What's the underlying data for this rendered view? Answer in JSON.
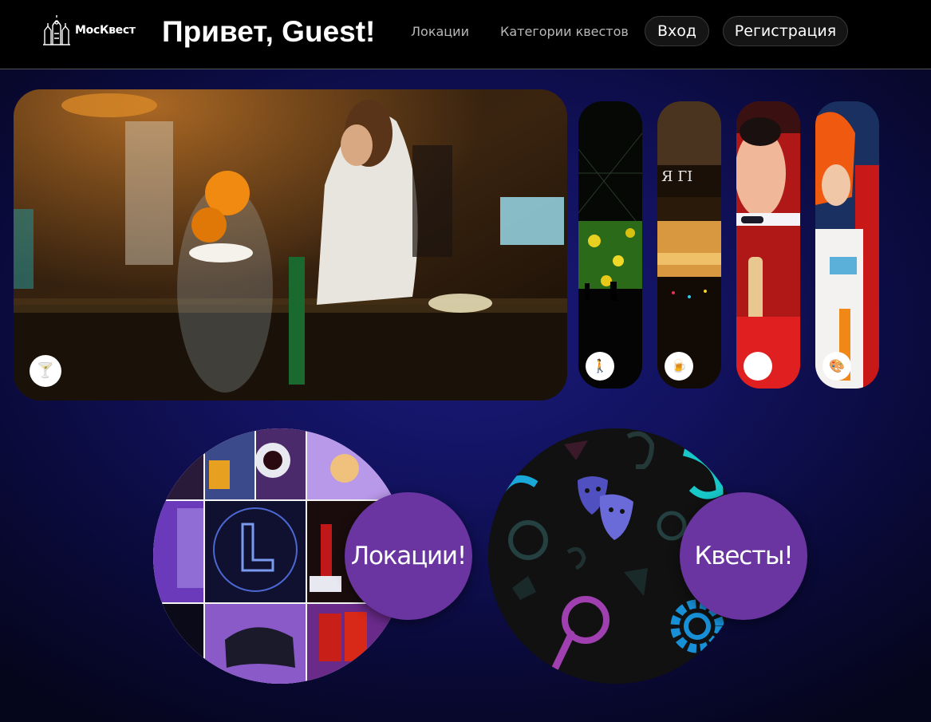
{
  "header": {
    "logo_text": "МосКвест",
    "greeting": "Привет, Guest!",
    "nav": {
      "locations": "Локации",
      "categories": "Категории квестов"
    },
    "buttons": {
      "login": "Вход",
      "register": "Регистрация"
    }
  },
  "carousel": {
    "cards": [
      {
        "icon": "cocktail-icon",
        "glyph": "🍸"
      },
      {
        "icon": "walking-person-icon",
        "glyph": "🚶"
      },
      {
        "icon": "beer-mug-icon",
        "glyph": "🍺"
      },
      {
        "icon": "hot-drink-icon",
        "glyph": "☕"
      },
      {
        "icon": "palette-icon",
        "glyph": "🎨"
      }
    ]
  },
  "sections": {
    "locations_button": "Локации!",
    "quests_button": "Квесты!"
  },
  "colors": {
    "header_bg": "#000000",
    "page_bg": "#121260",
    "button_purple": "#6a35a0"
  }
}
